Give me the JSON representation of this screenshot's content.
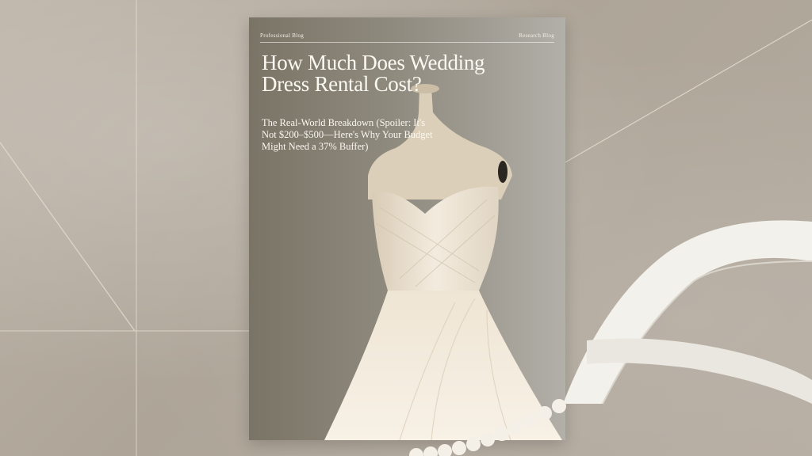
{
  "cover": {
    "brand": "Professional Blog",
    "issue": "Research Blog",
    "title": "How Much Does Wedding Dress Rental Cost?",
    "subtitle": "The Real-World Breakdown (Spoiler: It's Not $200–$500—Here's Why Your Budget Might Need a 37% Buffer)"
  },
  "icons": {
    "dress": "mannequin-dress-icon",
    "ribbon": "satin-ribbon-icon",
    "pearls": "pearl-strand-icon"
  },
  "colors": {
    "background": "#b7aea2",
    "cover": "#8f8a7e",
    "title_text": "#fbf8f2",
    "dress": "#efe6d6"
  }
}
